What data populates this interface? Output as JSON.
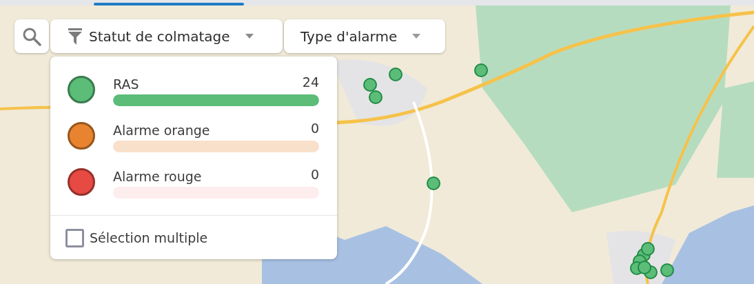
{
  "toolbar": {
    "filters": [
      {
        "label": "Statut de colmatage",
        "kind": "filter",
        "expanded": true
      },
      {
        "label": "Type d'alarme",
        "kind": "plain",
        "expanded": false
      }
    ]
  },
  "status_menu": {
    "items": [
      {
        "label": "RAS",
        "count": "24",
        "level": 1,
        "color": "#5bbd78"
      },
      {
        "label": "Alarme orange",
        "count": "0",
        "level": 0,
        "color": "#e8842f"
      },
      {
        "label": "Alarme rouge",
        "count": "0",
        "level": 0,
        "color": "#e64a42"
      }
    ],
    "multiple_selection": {
      "label": "Sélection multiple",
      "checked": false
    }
  }
}
